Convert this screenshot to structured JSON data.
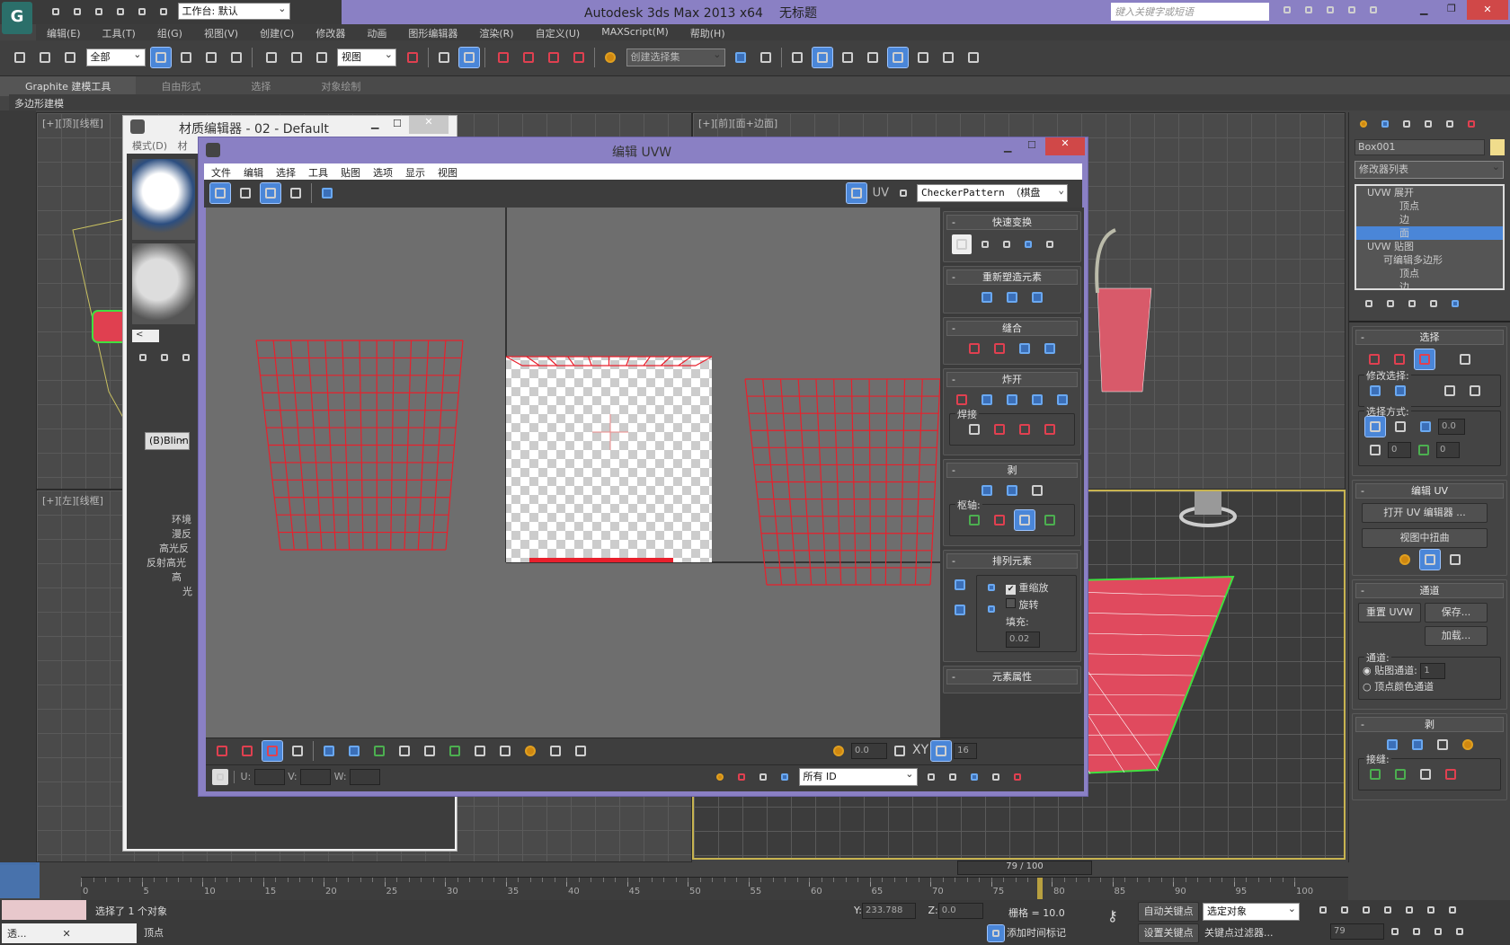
{
  "app": {
    "title": "Autodesk 3ds Max  2013 x64",
    "doc": "无标题",
    "workspace": "工作台: 默认",
    "search_placeholder": "键入关键字或短语"
  },
  "menu": [
    "编辑(E)",
    "工具(T)",
    "组(G)",
    "视图(V)",
    "创建(C)",
    "修改器",
    "动画",
    "图形编辑器",
    "渲染(R)",
    "自定义(U)",
    "MAXScript(M)",
    "帮助(H)"
  ],
  "toolbar": {
    "filter": "全部",
    "refcoord": "视图",
    "selset": "创建选择集"
  },
  "ribbon": {
    "tabs": [
      "Graphite 建模工具",
      "自由形式",
      "选择",
      "对象绘制"
    ],
    "sub": "多边形建模"
  },
  "viewports": {
    "top": "[+][顶][线框]",
    "left": "[+][左][线框]",
    "front": "[+][前][面+边面]"
  },
  "mat_editor": {
    "title": "材质编辑器 - 02 - Default",
    "menu": [
      "模式(D)",
      "材"
    ],
    "shader": "(B)Blinn",
    "params": [
      "环境",
      "漫反",
      "高光反"
    ],
    "spec_group": "反射高光",
    "spec_items": [
      "高",
      "光"
    ]
  },
  "uvw": {
    "title": "编辑 UVW",
    "menu": [
      "文件",
      "编辑",
      "选择",
      "工具",
      "贴图",
      "选项",
      "显示",
      "视图"
    ],
    "uv_label": "UV",
    "texture": "CheckerPattern （棋盘",
    "bottom": {
      "soft_val": "0.0",
      "xy": "XY",
      "grid_val": "16",
      "u": "U:",
      "v": "V:",
      "w": "W:",
      "id_filter": "所有 ID"
    },
    "rollouts": {
      "quick": "快速变换",
      "reshape": "重新塑造元素",
      "stitch": "缝合",
      "explode": "炸开",
      "weld": "焊接",
      "peel": "剥",
      "pivot": "枢轴:",
      "arrange": "排列元素",
      "rescale": "重缩放",
      "rotate": "旋转",
      "padding_label": "填充:",
      "padding": "0.02",
      "elem_props": "元素属性",
      "rescale_checked": true,
      "rotate_checked": false
    }
  },
  "cmd": {
    "object_name": "Box001",
    "object_color": "#f0dc8c",
    "modlist": "修改器列表",
    "stack": [
      {
        "label": "UVW 展开",
        "level": 0
      },
      {
        "label": "顶点",
        "level": 2
      },
      {
        "label": "边",
        "level": 2
      },
      {
        "label": "面",
        "level": 2,
        "selected": true
      },
      {
        "label": "UVW 贴图",
        "level": 0
      },
      {
        "label": "可编辑多边形",
        "level": 1
      },
      {
        "label": "顶点",
        "level": 2
      },
      {
        "label": "边",
        "level": 2
      }
    ],
    "select": "选择",
    "mod_select": "修改选择:",
    "select_by": "选择方式:",
    "sv1": "0.0",
    "sv2": "0",
    "sv3": "0",
    "edit_uv": "编辑 UV",
    "open_uv_editor": "打开 UV 编辑器 ...",
    "tweak": "视图中扭曲",
    "channel": "通道",
    "reset_uvw": "重置 UVW",
    "save": "保存...",
    "load": "加载...",
    "channel_group": "通道:",
    "map_channel": "贴图通道:",
    "map_channel_val": "1",
    "vertex_color": "顶点颜色通道",
    "peel": "剥",
    "seams": "接缝:"
  },
  "timeline": {
    "frame": "79 / 100",
    "ticks": [
      "0",
      "5",
      "10",
      "15",
      "20",
      "25",
      "30",
      "35",
      "40",
      "45",
      "50",
      "55",
      "60",
      "65",
      "70",
      "75",
      "80",
      "85",
      "90",
      "95",
      "100"
    ],
    "current": 79,
    "max": 100
  },
  "status": {
    "selected": "选择了 1 个对象",
    "prompt": "顶点",
    "y_label": "Y:",
    "y": "233.788",
    "z_label": "Z:",
    "z": "0.0",
    "grid": "栅格 = 10.0",
    "add_time_tag": "添加时间标记",
    "auto_key": "自动关键点",
    "set_key": "设置关键点",
    "key_mode": "选定对象",
    "key_filters": "关键点过滤器...",
    "frame_field": "79",
    "taskbar": "透..."
  },
  "colors": {
    "title_bar": "#8a80c4",
    "selection": "#4a86d8",
    "mesh": "#e8202c",
    "bag": "#e04a5e"
  }
}
